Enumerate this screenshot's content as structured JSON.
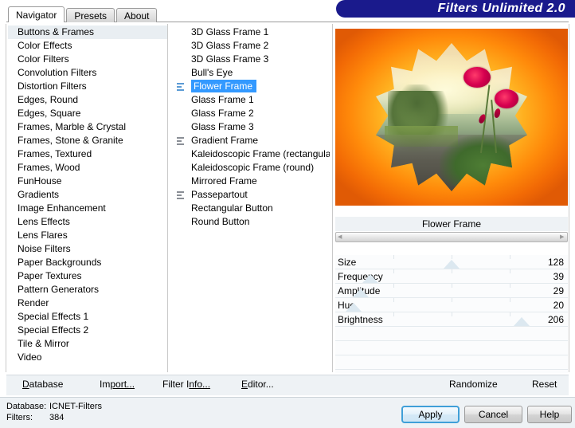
{
  "window": {
    "title": "Filters Unlimited 2.0",
    "banner_color": "#1a1a8c",
    "accent_color": "#3399ff"
  },
  "tabs": [
    {
      "label": "Navigator",
      "active": true
    },
    {
      "label": "Presets",
      "active": false
    },
    {
      "label": "About",
      "active": false
    }
  ],
  "categories": {
    "selected": "Buttons & Frames",
    "items": [
      "Buttons & Frames",
      "Color Effects",
      "Color Filters",
      "Convolution Filters",
      "Distortion Filters",
      "Edges, Round",
      "Edges, Square",
      "Frames, Marble & Crystal",
      "Frames, Stone & Granite",
      "Frames, Textured",
      "Frames, Wood",
      "FunHouse",
      "Gradients",
      "Image Enhancement",
      "Lens Effects",
      "Lens Flares",
      "Noise Filters",
      "Paper Backgrounds",
      "Paper Textures",
      "Pattern Generators",
      "Render",
      "Special Effects 1",
      "Special Effects 2",
      "Tile & Mirror",
      "Video"
    ]
  },
  "filters": {
    "selected": "Flower Frame",
    "items": [
      {
        "label": "3D Glass Frame 1",
        "icon": false
      },
      {
        "label": "3D Glass Frame 2",
        "icon": false
      },
      {
        "label": "3D Glass Frame 3",
        "icon": false
      },
      {
        "label": "Bull's Eye",
        "icon": false
      },
      {
        "label": "Flower Frame",
        "icon": true
      },
      {
        "label": "Glass Frame 1",
        "icon": false
      },
      {
        "label": "Glass Frame 2",
        "icon": false
      },
      {
        "label": "Glass Frame 3",
        "icon": false
      },
      {
        "label": "Gradient Frame",
        "icon": true
      },
      {
        "label": "Kaleidoscopic Frame (rectangular)",
        "icon": false
      },
      {
        "label": "Kaleidoscopic Frame (round)",
        "icon": false
      },
      {
        "label": "Mirrored Frame",
        "icon": false
      },
      {
        "label": "Passepartout",
        "icon": true
      },
      {
        "label": "Rectangular Button",
        "icon": false
      },
      {
        "label": "Round Button",
        "icon": false
      }
    ]
  },
  "preview": {
    "caption": "Flower Frame",
    "scrollbar_left_icon": "left-arrow-icon",
    "scrollbar_right_icon": "right-arrow-icon"
  },
  "parameters": [
    {
      "label": "Size",
      "value": "128",
      "pos": 50
    },
    {
      "label": "Frequency",
      "value": "39",
      "pos": 15
    },
    {
      "label": "Amplitude",
      "value": "29",
      "pos": 11
    },
    {
      "label": "Hue",
      "value": "20",
      "pos": 8
    },
    {
      "label": "Brightness",
      "value": "206",
      "pos": 80
    }
  ],
  "actions": {
    "database": {
      "pre": "D",
      "post": "atabase"
    },
    "import": {
      "pre": "Im",
      "post": "port..."
    },
    "filter_info": {
      "pre": "Filter I",
      "post": "nfo..."
    },
    "editor": {
      "pre": "E",
      "post": "ditor..."
    },
    "randomize": "Randomize",
    "reset": "Reset"
  },
  "status": {
    "database_key": "Database:",
    "database_value": "ICNET-Filters",
    "filters_key": "Filters:",
    "filters_value": "384"
  },
  "dialog_buttons": {
    "apply": "Apply",
    "cancel": "Cancel",
    "help": "Help"
  }
}
